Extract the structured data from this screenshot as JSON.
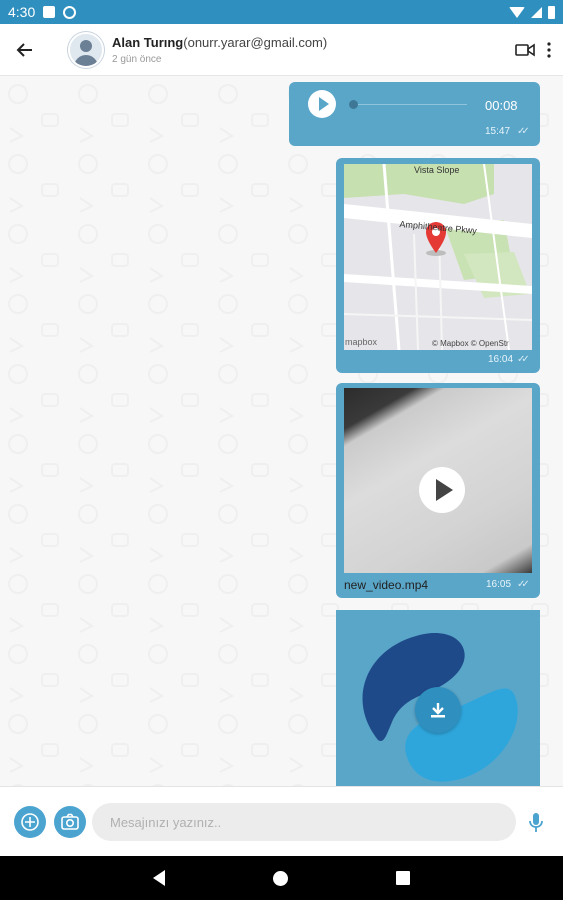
{
  "status_bar": {
    "time": "4:30",
    "icons": [
      "sd-card-icon",
      "sync-icon",
      "wifi-icon",
      "signal-icon",
      "battery-icon"
    ]
  },
  "header": {
    "contact_name": "Alan Turıng",
    "contact_email": "(onurr.yarar@gmail.com)",
    "last_seen": "2 gün önce",
    "icons": [
      "back-arrow-icon",
      "avatar",
      "video-call-icon",
      "more-vert-icon"
    ]
  },
  "messages": [
    {
      "type": "audio",
      "duration": "00:08",
      "time": "15:47",
      "progress": 0.0
    },
    {
      "type": "location",
      "time": "16:04",
      "map_labels": {
        "top": "Vista Slope",
        "road": "Amphitheatre Pkwy",
        "attribution": "© Mapbox © OpenStr",
        "logo": "mapbox"
      }
    },
    {
      "type": "video",
      "filename": "new_video.mp4",
      "time": "16:05"
    },
    {
      "type": "image",
      "status": "not-downloaded"
    }
  ],
  "composer": {
    "placeholder": "Mesajınızı yazınız..",
    "value": ""
  },
  "colors": {
    "status_bar": "#2f8fbf",
    "bubble": "#5aa6c9",
    "accent": "#4ba3cf",
    "image_dark": "#1f4a8a",
    "image_light": "#2ea6dc"
  }
}
